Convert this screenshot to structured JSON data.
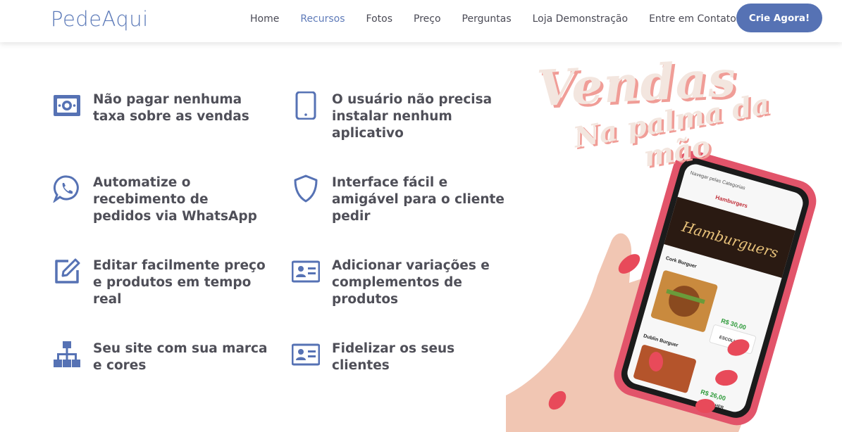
{
  "navbar": {
    "logo": "PedeAqui",
    "links": [
      "Home",
      "Recursos",
      "Fotos",
      "Preço",
      "Perguntas",
      "Loja Demonstração",
      "Entre em Contato"
    ],
    "active_link": "Recursos",
    "cta": "Crie Agora!"
  },
  "features": [
    {
      "text": "Não pagar nenhuma taxa sobre as vendas",
      "icon": "money-icon"
    },
    {
      "text": "O usuário não precisa instalar nenhum aplicativo",
      "icon": "mobile-icon"
    },
    {
      "text": "Automatize o recebimento de pedidos via WhatsApp",
      "icon": "whatsapp-icon"
    },
    {
      "text": "Interface fácil e amigável para o cliente pedir",
      "icon": "shield-icon"
    },
    {
      "text": "Editar facilmente preço e produtos em tempo real",
      "icon": "edit-icon"
    },
    {
      "text": "Adicionar variações e complementos de produtos",
      "icon": "id-card-icon"
    },
    {
      "text": "Seu site com sua marca e cores",
      "icon": "sitemap-icon"
    },
    {
      "text": "Fidelizar os seus clientes",
      "icon": "id-card-icon"
    }
  ],
  "hero": {
    "title": "Vendas",
    "subtitle": "Na palma da mão",
    "phone": {
      "nav_label": "Navegar pelas Categorias",
      "category": "Hamburgers",
      "banner": "Hamburguers",
      "items": [
        {
          "name": "Cork Burguer",
          "price": "R$ 30,00",
          "button": "ESCOLHER"
        },
        {
          "name": "Dublin Burguer",
          "price": "R$ 26,00",
          "button": "ESCOLHER"
        }
      ]
    }
  },
  "colors": {
    "accent": "#5672b4",
    "text": "#4f4f58",
    "hero_pink": "#f09d97"
  }
}
